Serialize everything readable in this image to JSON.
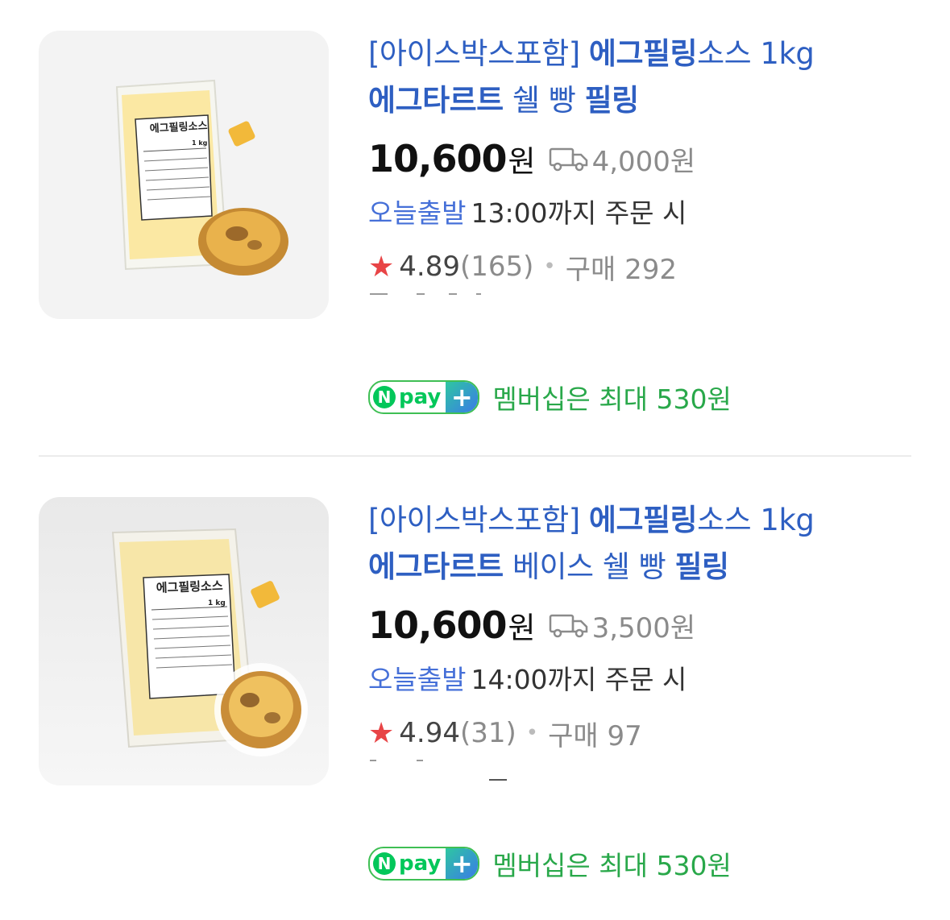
{
  "products": [
    {
      "title_prefix": "[아이스박스포함] ",
      "title_bold1": "에그필링",
      "title_mid1": "소스 1kg",
      "title_bold2": "에그타르트",
      "title_mid2": " 쉘 빵 ",
      "title_bold3": "필링",
      "price": "10,600",
      "price_unit": "원",
      "shipping": "4,000원",
      "today_label": "오늘출발",
      "today_text": "13:00까지 주문 시",
      "rating": "4.89",
      "review_count": "(165)",
      "dot": "•",
      "purchases": "구매 292",
      "npay_n": "N",
      "npay_text": "pay",
      "npay_plus": "+",
      "npay_label": "멤버십은 최대 530원",
      "package_label": "에그필링소스",
      "package_weight": "1 kg",
      "accent_color": "#fbe8a3"
    },
    {
      "title_prefix": "[아이스박스포함] ",
      "title_bold1": "에그필링",
      "title_mid1": "소스 1kg",
      "title_bold2": "에그타르트",
      "title_mid2": " 베이스 쉘 빵 ",
      "title_bold3": "필링",
      "price": "10,600",
      "price_unit": "원",
      "shipping": "3,500원",
      "today_label": "오늘출발",
      "today_text": "14:00까지 주문 시",
      "rating": "4.94",
      "review_count": "(31)",
      "dot": "•",
      "purchases": "구매 97",
      "npay_n": "N",
      "npay_text": "pay",
      "npay_plus": "+",
      "npay_label": "멤버십은 최대 530원",
      "package_label": "에그필링소스",
      "package_weight": "1 kg",
      "accent_color": "#f7e6a8"
    }
  ],
  "icons": {
    "truck": "truck-icon",
    "star": "star-icon"
  }
}
